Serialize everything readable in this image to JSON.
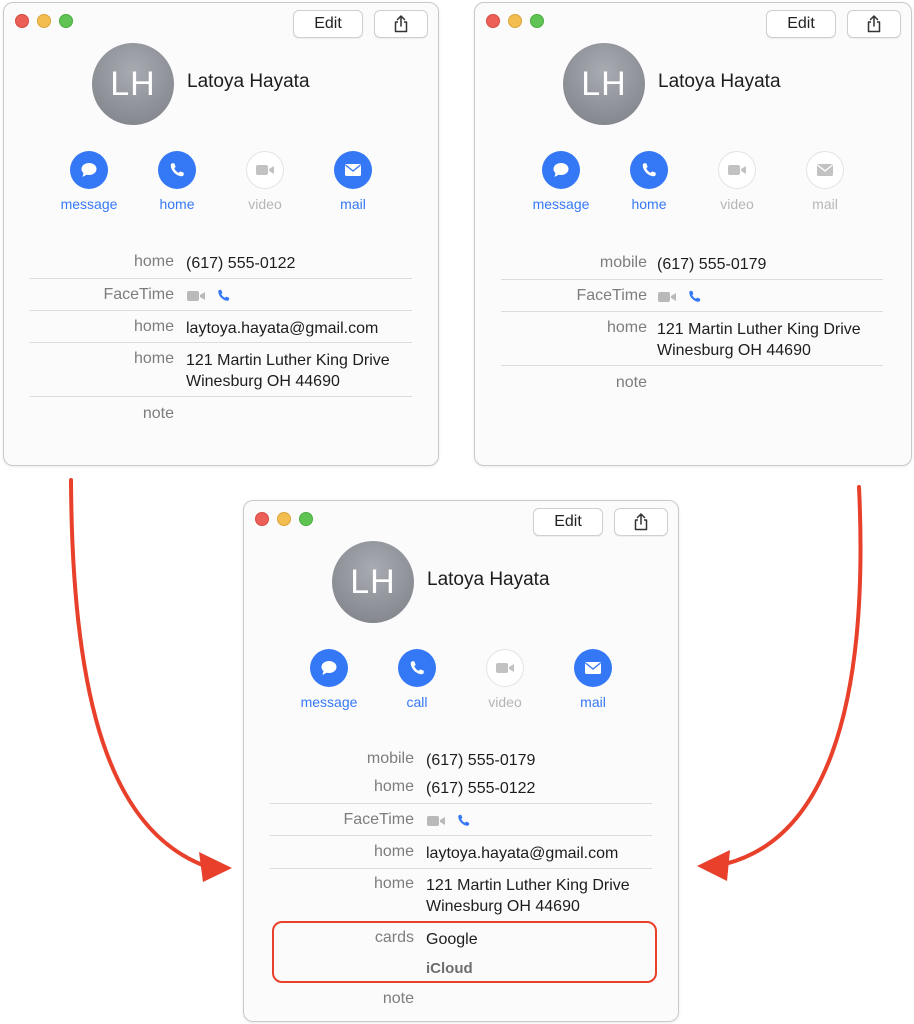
{
  "colors": {
    "accent": "#3478f6",
    "arrow": "#e8402a",
    "highlight": "#e8402a"
  },
  "left_card": {
    "edit_label": "Edit",
    "initials": "LH",
    "name": "Latoya Hayata",
    "actions": [
      {
        "label": "message",
        "icon": "message-icon",
        "enabled": true
      },
      {
        "label": "home",
        "icon": "phone-icon",
        "enabled": true
      },
      {
        "label": "video",
        "icon": "video-icon",
        "enabled": false
      },
      {
        "label": "mail",
        "icon": "mail-icon",
        "enabled": true
      }
    ],
    "fields": {
      "phone": {
        "label": "home",
        "value": "(617) 555-0122"
      },
      "facetime": {
        "label": "FaceTime"
      },
      "email": {
        "label": "home",
        "value": "laytoya.hayata@gmail.com"
      },
      "address": {
        "label": "home",
        "line1": "121 Martin Luther King Drive",
        "line2": "Winesburg OH 44690"
      },
      "note": {
        "label": "note"
      }
    }
  },
  "right_card": {
    "edit_label": "Edit",
    "initials": "LH",
    "name": "Latoya Hayata",
    "actions": [
      {
        "label": "message",
        "icon": "message-icon",
        "enabled": true
      },
      {
        "label": "home",
        "icon": "phone-icon",
        "enabled": true
      },
      {
        "label": "video",
        "icon": "video-icon",
        "enabled": false
      },
      {
        "label": "mail",
        "icon": "mail-icon",
        "enabled": false
      }
    ],
    "fields": {
      "phone": {
        "label": "mobile",
        "value": "(617) 555-0179"
      },
      "facetime": {
        "label": "FaceTime"
      },
      "address": {
        "label": "home",
        "line1": "121 Martin Luther King Drive",
        "line2": "Winesburg OH 44690"
      },
      "note": {
        "label": "note"
      }
    }
  },
  "merged_card": {
    "edit_label": "Edit",
    "initials": "LH",
    "name": "Latoya Hayata",
    "actions": [
      {
        "label": "message",
        "icon": "message-icon",
        "enabled": true
      },
      {
        "label": "call",
        "icon": "phone-icon",
        "enabled": true
      },
      {
        "label": "video",
        "icon": "video-icon",
        "enabled": false
      },
      {
        "label": "mail",
        "icon": "mail-icon",
        "enabled": true
      }
    ],
    "fields": {
      "mobile": {
        "label": "mobile",
        "value": "(617) 555-0179"
      },
      "home_phone": {
        "label": "home",
        "value": "(617) 555-0122"
      },
      "facetime": {
        "label": "FaceTime"
      },
      "email": {
        "label": "home",
        "value": "laytoya.hayata@gmail.com"
      },
      "address": {
        "label": "home",
        "line1": "121 Martin Luther King Drive",
        "line2": "Winesburg OH 44690"
      },
      "cards": {
        "label": "cards",
        "values": [
          "Google",
          "iCloud"
        ]
      },
      "note": {
        "label": "note"
      }
    }
  }
}
